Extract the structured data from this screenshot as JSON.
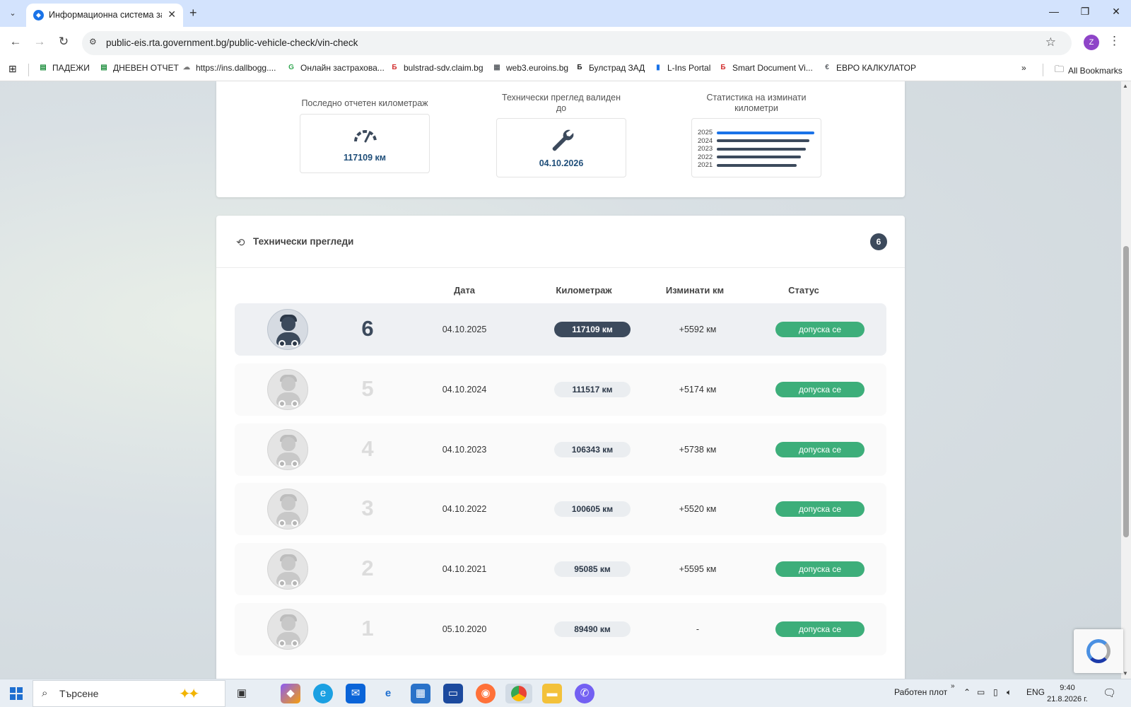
{
  "browser": {
    "tab_title": "Информационна система за п",
    "url": "public-eis.rta.government.bg/public-vehicle-check/vin-check",
    "profile_initial": "Z",
    "bookmarks": [
      {
        "label": "ПАДЕЖИ",
        "icon": "sheet-icon",
        "color": "#1e8e3e"
      },
      {
        "label": "ДНЕВЕН ОТЧЕТ",
        "icon": "sheet-icon",
        "color": "#1e8e3e"
      },
      {
        "label": "https://ins.dallbogg....",
        "icon": "cloud-icon",
        "color": "#777777"
      },
      {
        "label": "Онлайн застрахова...",
        "icon": "g-icon",
        "color": "#34a853"
      },
      {
        "label": "bulstrad-sdv.claim.bg",
        "icon": "b-icon",
        "color": "#d32f2f"
      },
      {
        "label": "web3.euroins.bg",
        "icon": "page-icon",
        "color": "#5f6368"
      },
      {
        "label": "Булстрад ЗАД",
        "icon": "b-icon",
        "color": "#222222"
      },
      {
        "label": "L-Ins Portal",
        "icon": "doc-icon",
        "color": "#1a73e8"
      },
      {
        "label": "Smart Document Vi...",
        "icon": "b-icon",
        "color": "#d32f2f"
      },
      {
        "label": "ЕВРО КАЛКУЛАТОР",
        "icon": "euro-icon",
        "color": "#5f6368"
      }
    ],
    "all_bookmarks": "All Bookmarks"
  },
  "summary": {
    "last_km_label": "Последно отчетен километраж",
    "last_km_value": "117109 км",
    "inspection_label": "Технически преглед валиден до",
    "inspection_value": "04.10.2026",
    "stats_label": "Статистика на изминати километри",
    "mini_chart": [
      {
        "year": "2025",
        "fraction": 1.0,
        "color": "#1a73e8"
      },
      {
        "year": "2024",
        "fraction": 0.95,
        "color": "#3c4a5c"
      },
      {
        "year": "2023",
        "fraction": 0.91,
        "color": "#3c4a5c"
      },
      {
        "year": "2022",
        "fraction": 0.86,
        "color": "#3c4a5c"
      },
      {
        "year": "2021",
        "fraction": 0.82,
        "color": "#3c4a5c"
      }
    ]
  },
  "inspections": {
    "title": "Технически прегледи",
    "count": "6",
    "columns": {
      "date": "Дата",
      "km": "Километраж",
      "diff": "Изминати км",
      "status": "Статус"
    },
    "rows": [
      {
        "num": "6",
        "date": "04.10.2025",
        "km": "117109 км",
        "diff": "+5592 км",
        "status": "допуска се",
        "active": true
      },
      {
        "num": "5",
        "date": "04.10.2024",
        "km": "111517 км",
        "diff": "+5174 км",
        "status": "допуска се",
        "active": false
      },
      {
        "num": "4",
        "date": "04.10.2023",
        "km": "106343 км",
        "diff": "+5738 км",
        "status": "допуска се",
        "active": false
      },
      {
        "num": "3",
        "date": "04.10.2022",
        "km": "100605 км",
        "diff": "+5520 км",
        "status": "допуска се",
        "active": false
      },
      {
        "num": "2",
        "date": "04.10.2021",
        "km": "95085 км",
        "diff": "+5595 км",
        "status": "допуска се",
        "active": false
      },
      {
        "num": "1",
        "date": "05.10.2020",
        "km": "89490 км",
        "diff": "-",
        "status": "допуска се",
        "active": false
      }
    ]
  },
  "taskbar": {
    "search_placeholder": "Търсене",
    "desktop_label": "Работен плот",
    "lang": "ENG",
    "time": "9:40",
    "date": "21.8.2026 г."
  }
}
